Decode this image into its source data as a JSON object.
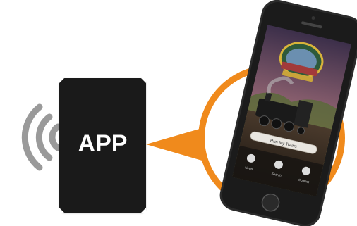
{
  "app_card": {
    "label": "APP"
  },
  "phone": {
    "button_label": "Run My Trains",
    "nav": [
      {
        "label": "News",
        "icon": "news-icon"
      },
      {
        "label": "Search",
        "icon": "search-icon"
      },
      {
        "label": "Contact",
        "icon": "contact-icon"
      }
    ],
    "logo_icon": "railroad-logo-badge",
    "hero_icon": "steam-locomotive-photo"
  },
  "colors": {
    "accent_orange": "#f08a1c",
    "card_black": "#1a1a1a",
    "wave_gray": "#9a9a9a",
    "phone_body": "#2b2b2b"
  }
}
